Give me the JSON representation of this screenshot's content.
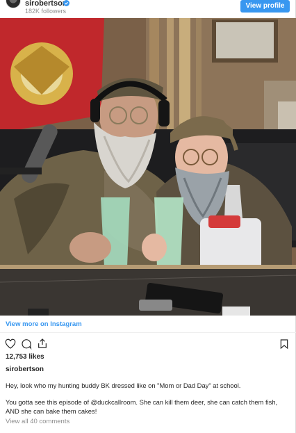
{
  "header": {
    "username": "sirobertson",
    "followers": "182K followers",
    "view_profile_label": "View profile",
    "verified_icon": "verified-badge-icon"
  },
  "post": {
    "view_more_label": "View more on Instagram",
    "likes": "12,753 likes",
    "caption_username": "sirobertson",
    "caption_line_1": "Hey, look who my hunting buddy BK dressed like on \"Mom or Dad Day\" at school.",
    "caption_line_2": "You gotta see this episode of @duckcallroom. She can kill them deer, she can catch them fish,",
    "caption_line_3": "AND she can bake them cakes!",
    "view_comments_label": "View all 40 comments"
  },
  "icons": {
    "like": "heart-icon",
    "comment": "comment-icon",
    "share": "share-icon",
    "save": "bookmark-icon"
  },
  "colors": {
    "accent": "#3897f0",
    "text": "#262626",
    "muted": "#8e8e8e"
  }
}
